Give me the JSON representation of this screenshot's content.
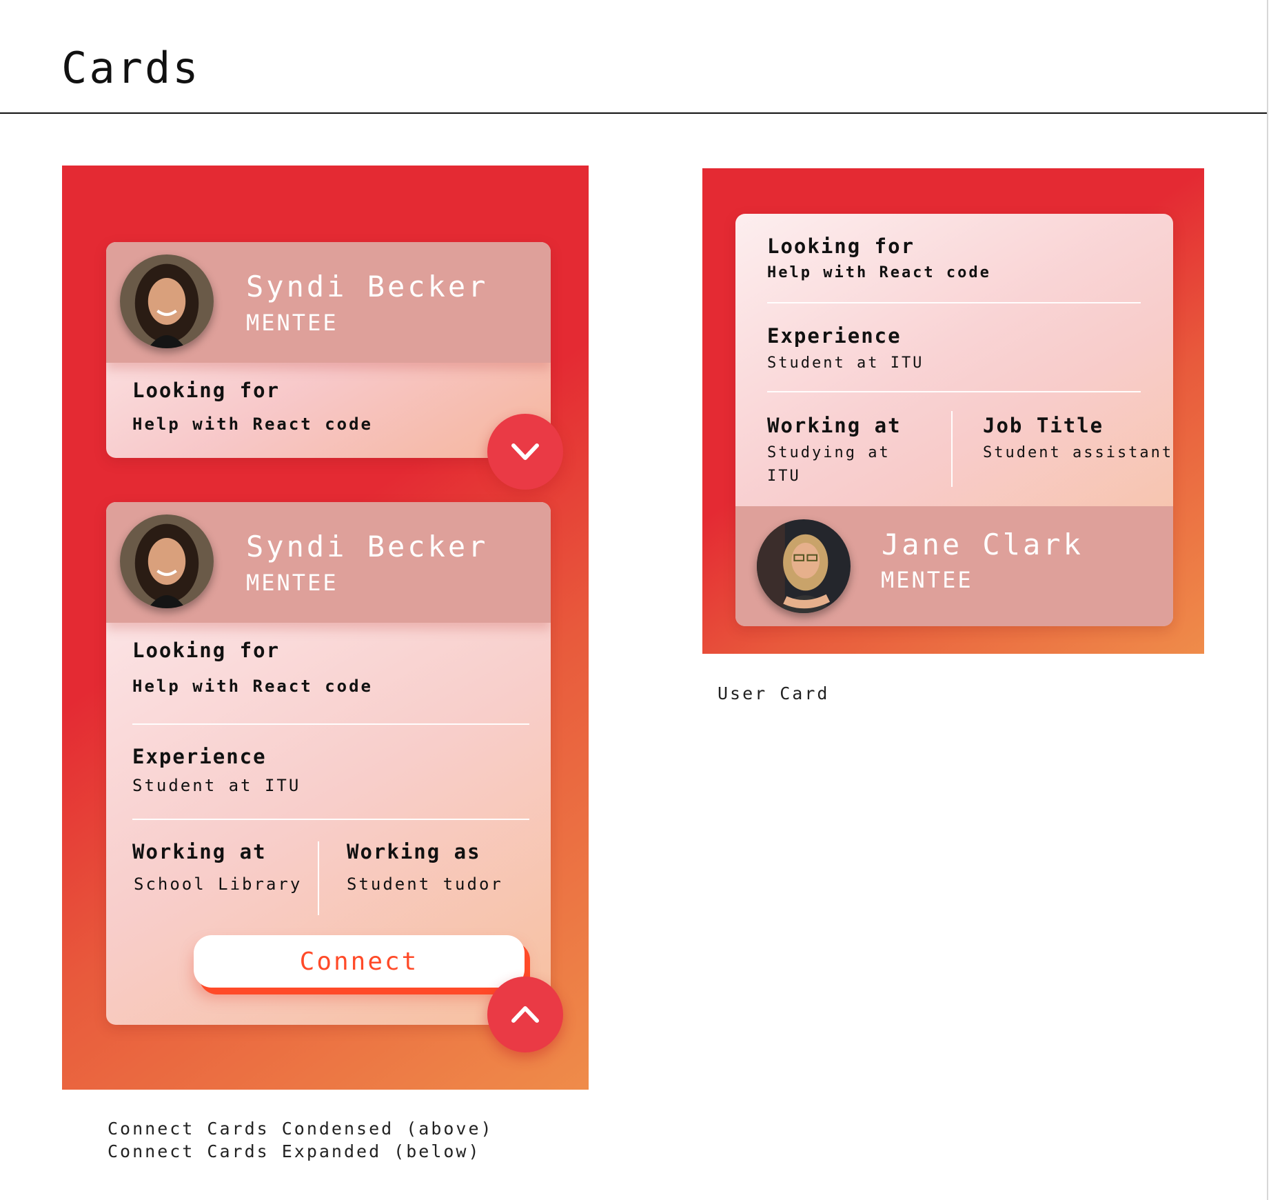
{
  "page": {
    "title": "Cards"
  },
  "condensed_card": {
    "name": "Syndi Becker",
    "role": "MENTEE",
    "looking_for_label": "Looking for",
    "looking_for_value": "Help with React code",
    "toggle_icon": "chevron-down-icon"
  },
  "expanded_card": {
    "name": "Syndi Becker",
    "role": "MENTEE",
    "looking_for_label": "Looking for",
    "looking_for_value": "Help with React code",
    "experience_label": "Experience",
    "experience_value": "Student at ITU",
    "working_at_label": "Working at",
    "working_at_value": "School Library",
    "working_as_label": "Working as",
    "working_as_value": "Student tudor",
    "connect_label": "Connect",
    "toggle_icon": "chevron-up-icon"
  },
  "user_card": {
    "looking_for_label": "Looking for",
    "looking_for_value": "Help with React code",
    "experience_label": "Experience",
    "experience_value": "Student at ITU",
    "working_at_label": "Working at",
    "working_at_value_line1": "Studying at",
    "working_at_value_line2": "ITU",
    "job_title_label": "Job Title",
    "job_title_value": "Student assistant",
    "name": "Jane Clark",
    "role": "MENTEE"
  },
  "captions": {
    "user_card": "User Card",
    "connect_condensed": "Connect Cards Condensed (above)",
    "connect_expanded": "Connect Cards Expanded (below)"
  },
  "colors": {
    "gradient_start": "#e42a33",
    "gradient_end": "#ef8c4a",
    "accent": "#ff4a28",
    "fab": "#ea3a45",
    "card_header": "#dea09a"
  }
}
